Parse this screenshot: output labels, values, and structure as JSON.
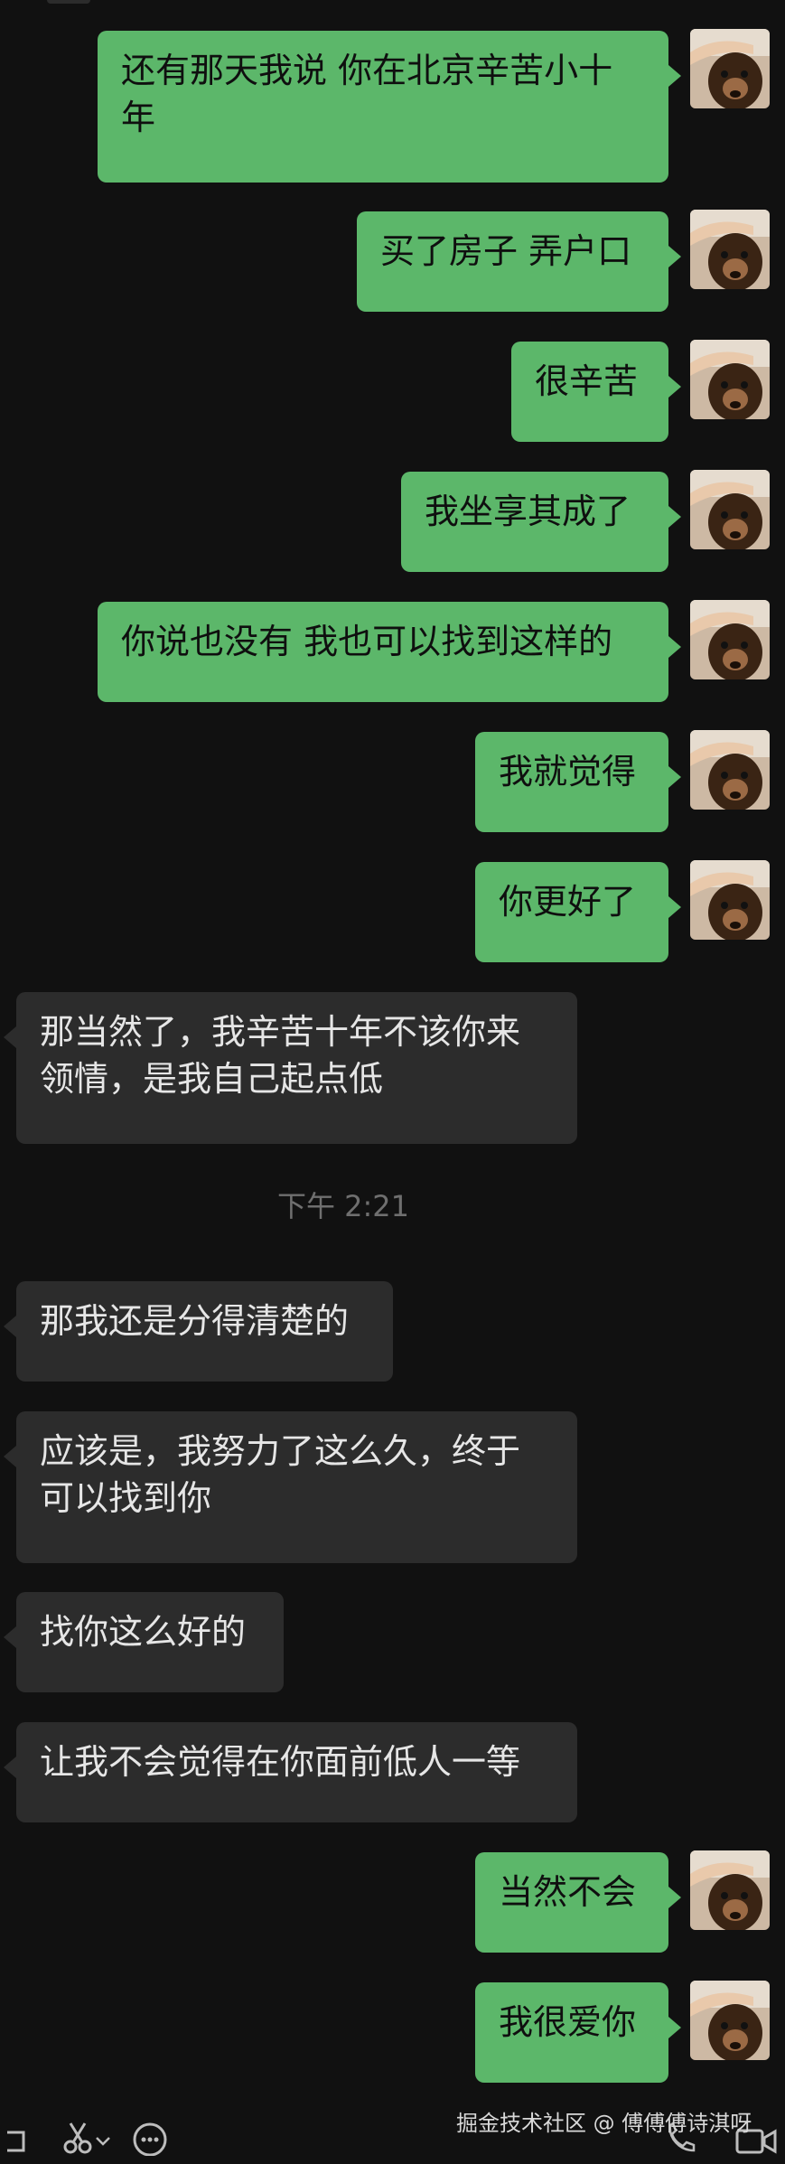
{
  "chat": {
    "messages": [
      {
        "side": "me",
        "text": "还有那天我说 你在北京辛苦小十\n年"
      },
      {
        "side": "me",
        "text": "买了房子 弄户口"
      },
      {
        "side": "me",
        "text": "很辛苦"
      },
      {
        "side": "me",
        "text": "我坐享其成了"
      },
      {
        "side": "me",
        "text": "你说也没有 我也可以找到这样的"
      },
      {
        "side": "me",
        "text": "我就觉得"
      },
      {
        "side": "me",
        "text": "你更好了"
      },
      {
        "side": "them",
        "text": "那当然了，我辛苦十年不该你来\n领情，是我自己起点低"
      },
      {
        "side": "them",
        "text": "那我还是分得清楚的"
      },
      {
        "side": "them",
        "text": "应该是，我努力了这么久，终于\n可以找到你"
      },
      {
        "side": "them",
        "text": "找你这么好的"
      },
      {
        "side": "them",
        "text": "让我不会觉得在你面前低人一等"
      },
      {
        "side": "me",
        "text": "当然不会"
      },
      {
        "side": "me",
        "text": "我很爱你"
      }
    ],
    "timestamp": "下午 2:21"
  },
  "footer": {
    "watermark": "掘金技术社区 @ 傅傅傅诗淇呀",
    "icons": [
      "scissors-icon",
      "chevron-down-icon",
      "emoji-icon",
      "phone-icon",
      "video-icon"
    ]
  },
  "colors": {
    "background": "#111111",
    "my_bubble": "#5cb76a",
    "their_bubble": "#2c2c2c"
  }
}
